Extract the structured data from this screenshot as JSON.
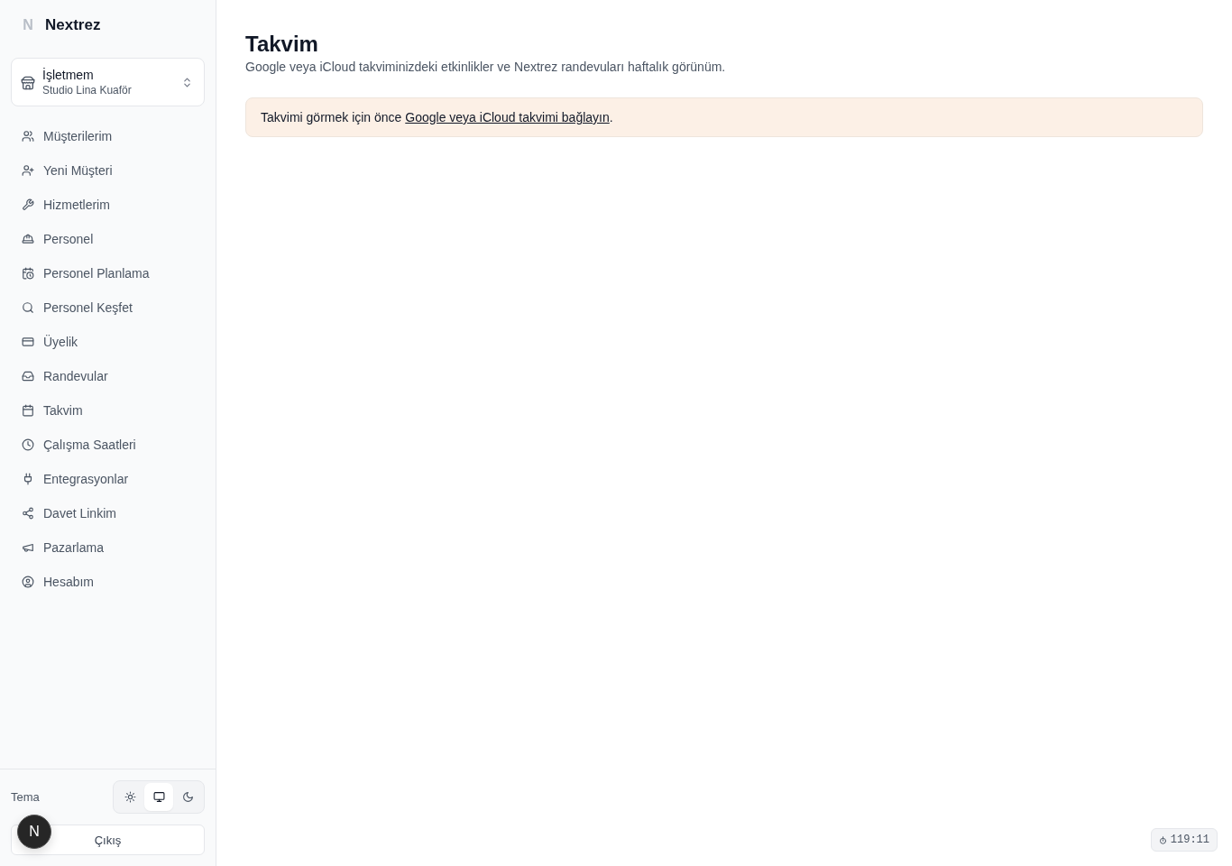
{
  "sidebar": {
    "logo": {
      "mark": "N",
      "name": "Nextrez"
    },
    "business_selector": {
      "label": "İşletmem",
      "value": "Studio Lina Kuaför"
    },
    "nav_items": [
      {
        "label": "Müşterilerim"
      },
      {
        "label": "Yeni Müşteri"
      },
      {
        "label": "Hizmetlerim"
      },
      {
        "label": "Personel"
      },
      {
        "label": "Personel Planlama"
      },
      {
        "label": "Personel Keşfet"
      },
      {
        "label": "Üyelik"
      },
      {
        "label": "Randevular"
      },
      {
        "label": "Takvim"
      },
      {
        "label": "Çalışma Saatleri"
      },
      {
        "label": "Entegrasyonlar"
      },
      {
        "label": "Davet Linkim"
      },
      {
        "label": "Pazarlama"
      },
      {
        "label": "Hesabım"
      }
    ],
    "theme": {
      "label": "Tema",
      "options": [
        {
          "kind": "light",
          "selected": false
        },
        {
          "kind": "system",
          "selected": true
        },
        {
          "kind": "dark",
          "selected": false
        }
      ]
    },
    "logout_button": "Çıkış"
  },
  "main": {
    "title": "Takvim",
    "subtitle": "Google veya iCloud takviminizdeki etkinlikler ve Nextrez randevuları haftalık görünüm.",
    "alert": {
      "text_before": "Takvimi görmek için önce ",
      "link": "Google veya iCloud takvimi bağlayın",
      "text_after": "."
    }
  },
  "floating_button": "N",
  "timer_badge": "119:11"
}
